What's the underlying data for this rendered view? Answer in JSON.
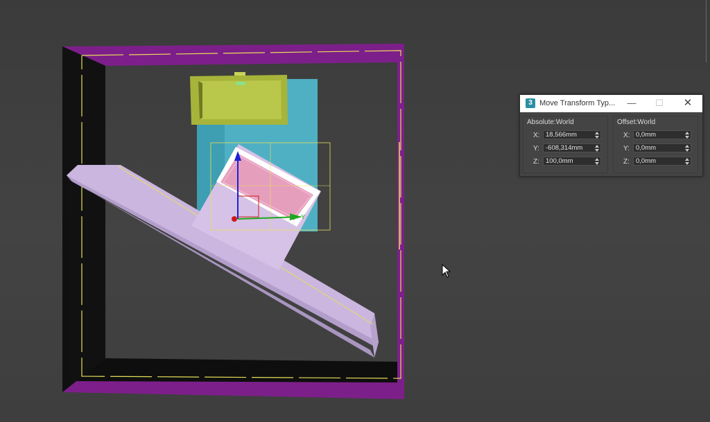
{
  "dialog": {
    "app_icon": "3ds-max-icon",
    "title": "Move Transform Typ...",
    "minimize_label": "—",
    "maximize_label": "☐",
    "close_label": "✕",
    "absolute": {
      "label": "Absolute:World",
      "x_label": "X:",
      "x_value": "18,566mm",
      "y_label": "Y:",
      "y_value": "-608,314mm",
      "z_label": "Z:",
      "z_value": "100,0mm"
    },
    "offset": {
      "label": "Offset:World",
      "x_label": "X:",
      "x_value": "0,0mm",
      "y_label": "Y:",
      "y_value": "0,0mm",
      "z_label": "Z:",
      "z_value": "0,0mm"
    }
  },
  "viewport": {
    "gizmo_axis_label": "Y",
    "colors": {
      "frame": "#7d1f8a",
      "selection_outline": "#e6e05a",
      "olive_box": "#a7b43a",
      "cyan_panel": "#4fb0c3",
      "lavender_slab": "#cbb6df",
      "pink_face": "#e69ebd",
      "gizmo_x": "#cc1a1a",
      "gizmo_y": "#1fa81f",
      "gizmo_z": "#1a22d6"
    }
  },
  "cursor": {
    "icon": "arrow-cursor-icon"
  }
}
